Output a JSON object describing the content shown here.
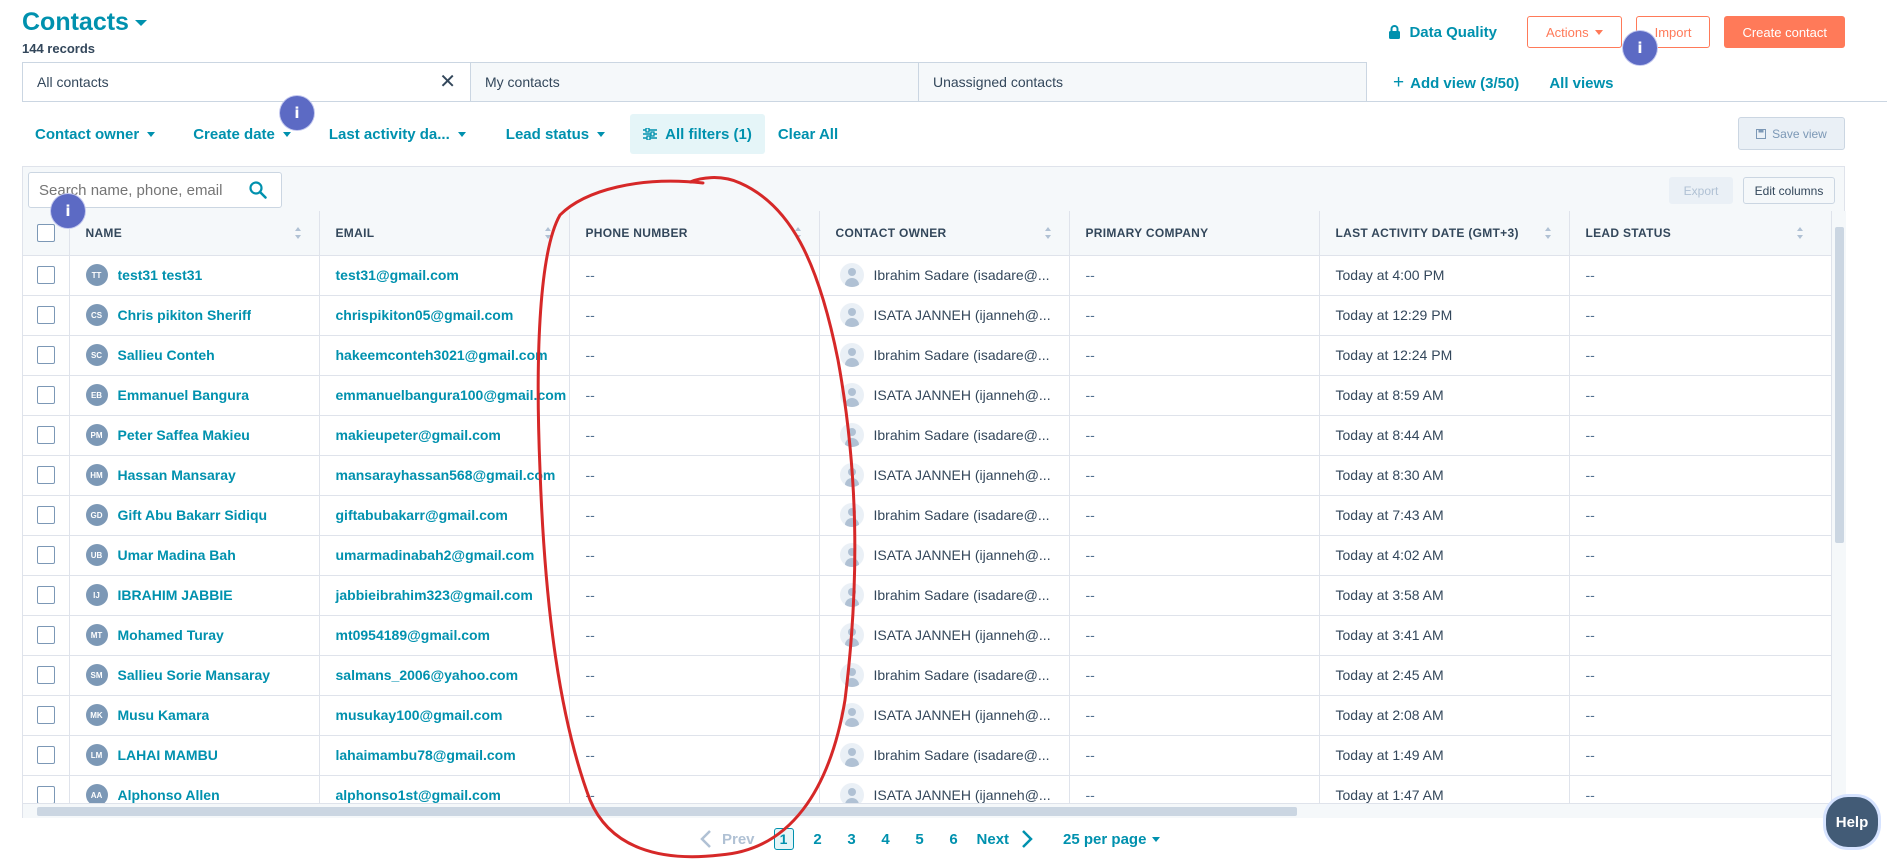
{
  "header": {
    "title": "Contacts",
    "record_count": "144 records",
    "data_quality": "Data Quality",
    "actions_label": "Actions",
    "import_label": "Import",
    "create_label": "Create contact"
  },
  "tabs": [
    {
      "label": "All contacts"
    },
    {
      "label": "My contacts"
    },
    {
      "label": "Unassigned contacts"
    }
  ],
  "view_actions": {
    "add_view": "Add view (3/50)",
    "all_views": "All views"
  },
  "filters": {
    "contact_owner": "Contact owner",
    "create_date": "Create date",
    "last_activity": "Last activity da...",
    "lead_status": "Lead status",
    "all_filters": "All filters (1)",
    "clear_all": "Clear All",
    "save_view": "Save view"
  },
  "table": {
    "search_placeholder": "Search name, phone, email",
    "export_label": "Export",
    "edit_columns_label": "Edit columns",
    "columns": [
      "NAME",
      "EMAIL",
      "PHONE NUMBER",
      "CONTACT OWNER",
      "PRIMARY COMPANY",
      "LAST ACTIVITY DATE (GMT+3)",
      "LEAD STATUS"
    ],
    "rows": [
      {
        "initials": "TT",
        "name": "test31 test31",
        "email": "test31@gmail.com",
        "phone": "--",
        "owner": "Ibrahim Sadare (isadare@...",
        "company": "--",
        "last_activity": "Today at 4:00 PM",
        "lead_status": "--"
      },
      {
        "initials": "CS",
        "name": "Chris pikiton Sheriff",
        "email": "chrispikiton05@gmail.com",
        "phone": "--",
        "owner": "ISATA JANNEH (ijanneh@...",
        "company": "--",
        "last_activity": "Today at 12:29 PM",
        "lead_status": "--"
      },
      {
        "initials": "SC",
        "name": "Sallieu Conteh",
        "email": "hakeemconteh3021@gmail.com",
        "phone": "--",
        "owner": "Ibrahim Sadare (isadare@...",
        "company": "--",
        "last_activity": "Today at 12:24 PM",
        "lead_status": "--"
      },
      {
        "initials": "EB",
        "name": "Emmanuel Bangura",
        "email": "emmanuelbangura100@gmail.com",
        "phone": "--",
        "owner": "ISATA JANNEH (ijanneh@...",
        "company": "--",
        "last_activity": "Today at 8:59 AM",
        "lead_status": "--"
      },
      {
        "initials": "PM",
        "name": "Peter Saffea Makieu",
        "email": "makieupeter@gmail.com",
        "phone": "--",
        "owner": "Ibrahim Sadare (isadare@...",
        "company": "--",
        "last_activity": "Today at 8:44 AM",
        "lead_status": "--"
      },
      {
        "initials": "HM",
        "name": "Hassan Mansaray",
        "email": "mansarayhassan568@gmail.com",
        "phone": "--",
        "owner": "ISATA JANNEH (ijanneh@...",
        "company": "--",
        "last_activity": "Today at 8:30 AM",
        "lead_status": "--"
      },
      {
        "initials": "GD",
        "name": "Gift Abu Bakarr Sidiqu",
        "email": "giftabubakarr@gmail.com",
        "phone": "--",
        "owner": "Ibrahim Sadare (isadare@...",
        "company": "--",
        "last_activity": "Today at 7:43 AM",
        "lead_status": "--"
      },
      {
        "initials": "UB",
        "name": "Umar Madina Bah",
        "email": "umarmadinabah2@gmail.com",
        "phone": "--",
        "owner": "ISATA JANNEH (ijanneh@...",
        "company": "--",
        "last_activity": "Today at 4:02 AM",
        "lead_status": "--"
      },
      {
        "initials": "IJ",
        "name": "IBRAHIM JABBIE",
        "email": "jabbieibrahim323@gmail.com",
        "phone": "--",
        "owner": "Ibrahim Sadare (isadare@...",
        "company": "--",
        "last_activity": "Today at 3:58 AM",
        "lead_status": "--"
      },
      {
        "initials": "MT",
        "name": "Mohamed Turay",
        "email": "mt0954189@gmail.com",
        "phone": "--",
        "owner": "ISATA JANNEH (ijanneh@...",
        "company": "--",
        "last_activity": "Today at 3:41 AM",
        "lead_status": "--"
      },
      {
        "initials": "SM",
        "name": "Sallieu Sorie Mansaray",
        "email": "salmans_2006@yahoo.com",
        "phone": "--",
        "owner": "Ibrahim Sadare (isadare@...",
        "company": "--",
        "last_activity": "Today at 2:45 AM",
        "lead_status": "--"
      },
      {
        "initials": "MK",
        "name": "Musu Kamara",
        "email": "musukay100@gmail.com",
        "phone": "--",
        "owner": "ISATA JANNEH (ijanneh@...",
        "company": "--",
        "last_activity": "Today at 2:08 AM",
        "lead_status": "--"
      },
      {
        "initials": "LM",
        "name": "LAHAI MAMBU",
        "email": "lahaimambu78@gmail.com",
        "phone": "--",
        "owner": "Ibrahim Sadare (isadare@...",
        "company": "--",
        "last_activity": "Today at 1:49 AM",
        "lead_status": "--"
      },
      {
        "initials": "AA",
        "name": "Alphonso Allen",
        "email": "alphonso1st@gmail.com",
        "phone": "--",
        "owner": "ISATA JANNEH (ijanneh@...",
        "company": "--",
        "last_activity": "Today at 1:47 AM",
        "lead_status": "--"
      }
    ]
  },
  "pagination": {
    "prev": "Prev",
    "current": "1",
    "pages": [
      "2",
      "3",
      "4",
      "5",
      "6"
    ],
    "next": "Next",
    "per_page": "25 per page"
  },
  "help_label": "Help",
  "info_badge": "i",
  "colors": {
    "accent": "#0091ae",
    "cta": "#ff7a59",
    "annotation": "#d62828",
    "badge": "#5c6ac4"
  }
}
